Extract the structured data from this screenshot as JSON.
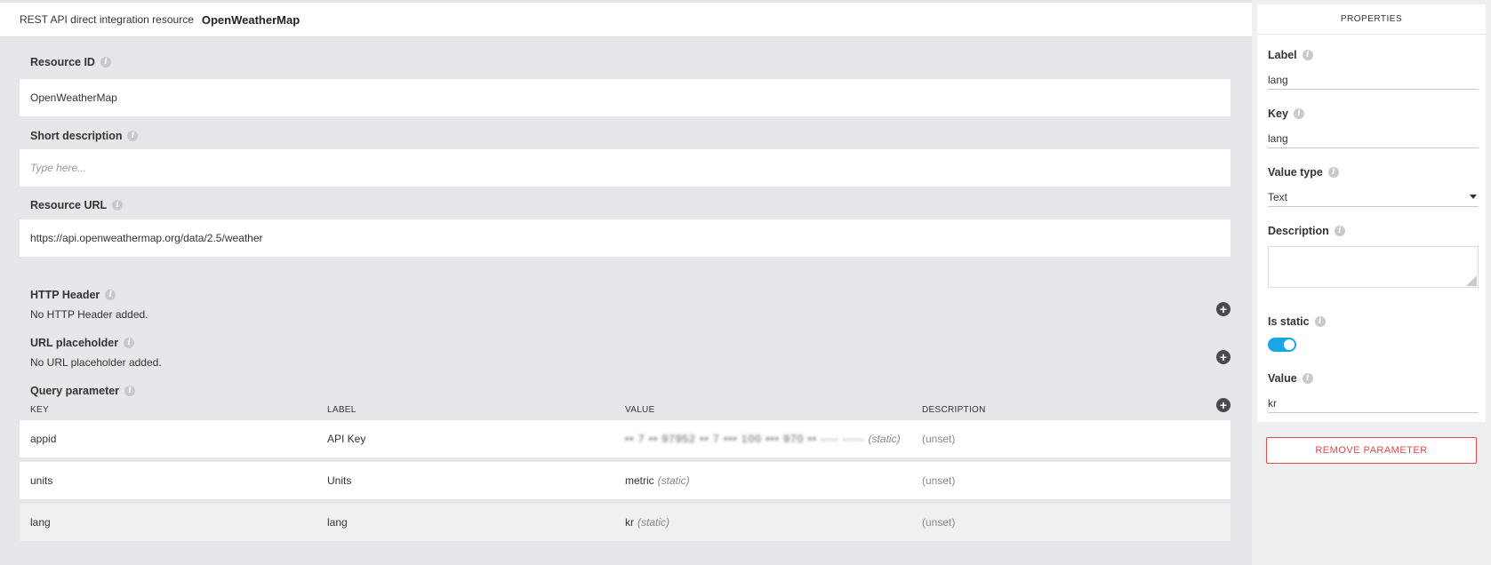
{
  "header": {
    "subtitle": "REST API direct integration resource",
    "resource_name": "OpenWeatherMap"
  },
  "form": {
    "resource_id": {
      "label": "Resource ID",
      "value": "OpenWeatherMap"
    },
    "short_description": {
      "label": "Short description",
      "placeholder": "Type here..."
    },
    "resource_url": {
      "label": "Resource URL",
      "value": "https://api.openweathermap.org/data/2.5/weather"
    }
  },
  "http_header": {
    "title": "HTTP Header",
    "empty_text": "No HTTP Header added."
  },
  "url_placeholder": {
    "title": "URL placeholder",
    "empty_text": "No URL placeholder added."
  },
  "query_parameter": {
    "title": "Query parameter",
    "columns": [
      "KEY",
      "LABEL",
      "VALUE",
      "DESCRIPTION"
    ],
    "rows": [
      {
        "key": "appid",
        "label": "API Key",
        "value": "•• 7 •• 97952 •• 7 ••• 100 ••• 970 •• ---- -----",
        "static_tag": "(static)",
        "description": "(unset)"
      },
      {
        "key": "units",
        "label": "Units",
        "value": "metric",
        "static_tag": "(static)",
        "description": "(unset)"
      },
      {
        "key": "lang",
        "label": "lang",
        "value": "kr",
        "static_tag": "(static)",
        "description": "(unset)"
      }
    ]
  },
  "properties": {
    "title": "PROPERTIES",
    "label": {
      "label": "Label",
      "value": "lang"
    },
    "key": {
      "label": "Key",
      "value": "lang"
    },
    "value_type": {
      "label": "Value type",
      "value": "Text"
    },
    "description": {
      "label": "Description"
    },
    "is_static": {
      "label": "Is static",
      "enabled": true
    },
    "value": {
      "label": "Value",
      "value": "kr"
    },
    "remove_button": "REMOVE PARAMETER"
  },
  "colors": {
    "accent": "#1aa6e8",
    "danger": "#e5484d",
    "background": "#e6e7ea"
  }
}
